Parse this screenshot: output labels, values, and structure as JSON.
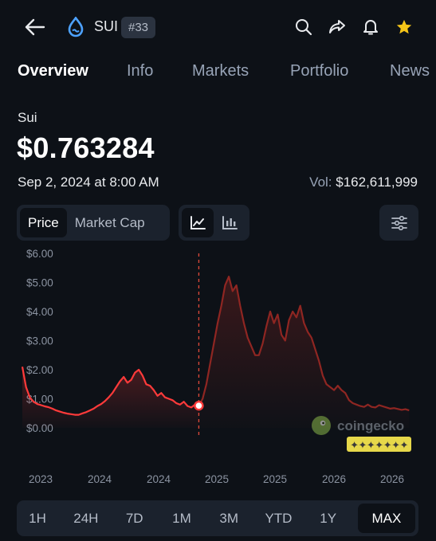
{
  "header": {
    "symbol": "SUI",
    "rank": "#33",
    "icons": [
      "back-arrow-icon",
      "sui-logo-icon",
      "search-icon",
      "share-icon",
      "bell-icon",
      "star-icon"
    ],
    "star_color": "#f5c518",
    "logo_color": "#4da2ff"
  },
  "tabs": [
    {
      "label": "Overview",
      "active": true
    },
    {
      "label": "Info",
      "active": false
    },
    {
      "label": "Markets",
      "active": false
    },
    {
      "label": "Portfolio",
      "active": false
    },
    {
      "label": "News",
      "active": false
    }
  ],
  "coin": {
    "name": "Sui",
    "price": "$0.763284",
    "timestamp": "Sep 2, 2024 at 8:00 AM",
    "volume_label": "Vol:",
    "volume_value": "$162,611,999"
  },
  "controls": {
    "metric_options": [
      "Price",
      "Market Cap"
    ],
    "metric_selected": "Price",
    "chart_types": [
      "line-chart-icon",
      "candlestick-icon"
    ],
    "chart_type_selected": "line-chart-icon",
    "filter_icon": "sliders-icon"
  },
  "chart_data": {
    "type": "line",
    "y_tick_labels": [
      "$0.00",
      "$1.00",
      "$2.00",
      "$3.00",
      "$4.00",
      "$5.00",
      "$6.00"
    ],
    "ylim": [
      0,
      6
    ],
    "x_tick_labels": [
      "2023",
      "2024",
      "2024",
      "2025",
      "2025",
      "2026",
      "2026"
    ],
    "selected_point": {
      "label": "Sep 2, 2024",
      "value": 0.763284
    },
    "series": [
      {
        "values_past": [
          2.1,
          1.4,
          1.05,
          0.9,
          0.82,
          0.78,
          0.74,
          0.71,
          0.66,
          0.6,
          0.56,
          0.52,
          0.49,
          0.47,
          0.45,
          0.45,
          0.5,
          0.54,
          0.6,
          0.66,
          0.75,
          0.82,
          0.92,
          1.05,
          1.2,
          1.4,
          1.6,
          1.75,
          1.55,
          1.65,
          1.9,
          2.0,
          1.8,
          1.5,
          1.45,
          1.3,
          1.1,
          1.2,
          1.05,
          1.0,
          0.95,
          0.85,
          0.8,
          0.9,
          0.75,
          0.7,
          0.8,
          0.76
        ],
        "values_forecast": [
          0.76,
          1.0,
          1.5,
          2.2,
          2.9,
          3.6,
          4.2,
          4.9,
          5.2,
          4.7,
          4.9,
          4.2,
          3.6,
          3.1,
          2.8,
          2.5,
          2.5,
          2.9,
          3.5,
          4.0,
          3.6,
          3.9,
          3.2,
          3.0,
          3.7,
          4.0,
          3.8,
          4.2,
          3.6,
          3.3,
          3.1,
          2.7,
          2.3,
          1.8,
          1.5,
          1.4,
          1.3,
          1.45,
          1.3,
          1.2,
          0.95,
          0.85,
          0.8,
          0.75,
          0.72,
          0.8,
          0.72,
          0.7,
          0.78,
          0.74,
          0.7,
          0.66,
          0.68,
          0.65,
          0.62,
          0.64,
          0.6
        ]
      }
    ],
    "colors": {
      "line_past": "#ff3a3a",
      "line_forecast": "#8f2622",
      "marker": "#ff3a3a",
      "cursor": "#e04a3a"
    },
    "watermark": "coingecko",
    "sticker": "✦✦✦✦✦✦✦"
  },
  "ranges": [
    {
      "label": "1H",
      "active": false
    },
    {
      "label": "24H",
      "active": false
    },
    {
      "label": "7D",
      "active": false
    },
    {
      "label": "1M",
      "active": false
    },
    {
      "label": "3M",
      "active": false
    },
    {
      "label": "YTD",
      "active": false
    },
    {
      "label": "1Y",
      "active": false
    },
    {
      "label": "MAX",
      "active": true
    }
  ]
}
